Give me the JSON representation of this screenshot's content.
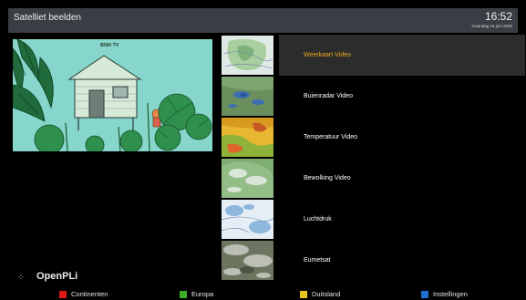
{
  "header": {
    "title": "Satelliet beelden",
    "time": "16:52",
    "date": "maandag 15 juni 2020"
  },
  "preview": {
    "channel_tag": "BNN TV"
  },
  "logo": {
    "text": "OpenPLi"
  },
  "menu": {
    "selected_index": 0,
    "selected_color": "#f0a91c",
    "items": [
      {
        "label": "Weerkaart Video",
        "thumb": "weather-map"
      },
      {
        "label": "Buienradar Video",
        "thumb": "rain-radar"
      },
      {
        "label": "Temperatuur Video",
        "thumb": "temperature"
      },
      {
        "label": "Bewolking Video",
        "thumb": "clouds"
      },
      {
        "label": "Luchtdruk",
        "thumb": "air-pressure"
      },
      {
        "label": "Eumetsat",
        "thumb": "satellite"
      }
    ]
  },
  "footer": {
    "red": {
      "label": "Continenten",
      "color": "#e01818"
    },
    "green": {
      "label": "Europa",
      "color": "#3cae2a"
    },
    "yellow": {
      "label": "Duitsland",
      "color": "#e8c51a"
    },
    "blue": {
      "label": "Instellingen",
      "color": "#1e6fd0"
    }
  }
}
